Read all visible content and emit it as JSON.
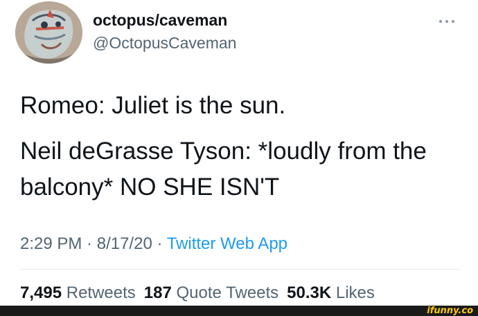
{
  "user": {
    "display_name": "octopus/caveman",
    "handle": "@OctopusCaveman",
    "avatar_icon": "profile-avatar"
  },
  "tweet": {
    "line1": "Romeo: Juliet is the sun.",
    "line2": "Neil deGrasse Tyson: *loudly from the",
    "line3": "balcony* NO SHE ISN'T"
  },
  "meta": {
    "time": "2:29 PM",
    "separator1": " · ",
    "date": "8/17/20",
    "separator2": " · ",
    "source": "Twitter Web App"
  },
  "stats": {
    "retweets_count": "7,495",
    "retweets_label": "Retweets",
    "quotes_count": "187",
    "quotes_label": "Quote Tweets",
    "likes_count": "50.3K",
    "likes_label": "Likes"
  },
  "watermark": {
    "text": "ifunny.co"
  },
  "colors": {
    "text_primary": "#0f1419",
    "text_secondary": "#536471",
    "link": "#1d9bf0",
    "divider": "#e6ecf0",
    "watermark": "#ffcc00"
  }
}
